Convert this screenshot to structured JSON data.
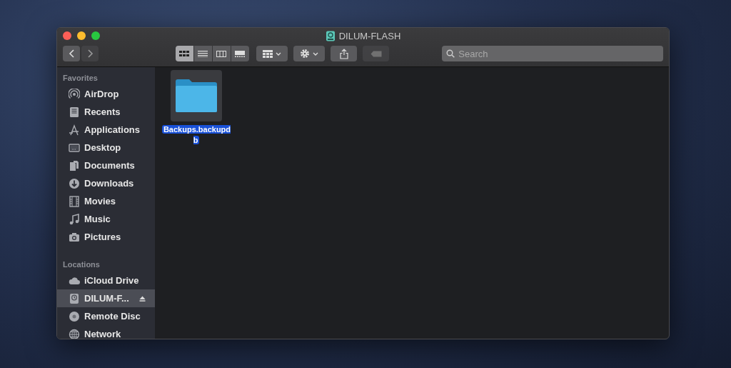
{
  "window": {
    "title": "DILUM-FLASH"
  },
  "toolbar": {
    "back": {
      "disabled": false
    },
    "forward": {
      "disabled": true
    },
    "view_modes": [
      {
        "kind": "icons",
        "selected": true
      },
      {
        "kind": "list",
        "selected": false
      },
      {
        "kind": "columns",
        "selected": false
      },
      {
        "kind": "gallery",
        "selected": false
      }
    ],
    "search": {
      "placeholder": "Search"
    }
  },
  "sidebar": {
    "sections": [
      {
        "title": "Favorites",
        "items": [
          {
            "kind": "airdrop",
            "label": "AirDrop",
            "selected": false
          },
          {
            "kind": "recents",
            "label": "Recents",
            "selected": false
          },
          {
            "kind": "applications",
            "label": "Applications",
            "selected": false
          },
          {
            "kind": "desktop",
            "label": "Desktop",
            "selected": false
          },
          {
            "kind": "documents",
            "label": "Documents",
            "selected": false
          },
          {
            "kind": "downloads",
            "label": "Downloads",
            "selected": false
          },
          {
            "kind": "movies",
            "label": "Movies",
            "selected": false
          },
          {
            "kind": "music",
            "label": "Music",
            "selected": false
          },
          {
            "kind": "pictures",
            "label": "Pictures",
            "selected": false
          }
        ]
      },
      {
        "title": "Locations",
        "items": [
          {
            "kind": "cloud",
            "label": "iCloud Drive",
            "selected": false
          },
          {
            "kind": "drive",
            "label": "DILUM-F...",
            "selected": true,
            "eject": true
          },
          {
            "kind": "disc",
            "label": "Remote Disc",
            "selected": false
          },
          {
            "kind": "network",
            "label": "Network",
            "selected": false
          }
        ]
      }
    ]
  },
  "files": [
    {
      "name": "Backups.backupdb",
      "selected": true
    }
  ]
}
